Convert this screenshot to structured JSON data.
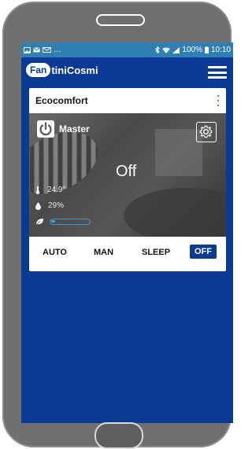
{
  "status_bar": {
    "left_icons": [
      "image-icon",
      "mail-icon",
      "voicemail-icon"
    ],
    "ellipsis": "…",
    "battery": "100%",
    "time": "10:10"
  },
  "app": {
    "logo_part1": "Fan",
    "logo_part2": "tiniCosmi"
  },
  "card": {
    "title": "Ecocomfort",
    "zone_name": "Master",
    "state": "Off",
    "temperature": "24.9°",
    "humidity": "29%",
    "eco_level": 0.1
  },
  "modes": [
    "AUTO",
    "MAN",
    "SLEEP",
    "OFF"
  ],
  "active_mode": "OFF",
  "colors": {
    "brand": "#0b3a94",
    "status_bar": "#2f7fb2",
    "eco_accent": "#3fa6e6"
  }
}
